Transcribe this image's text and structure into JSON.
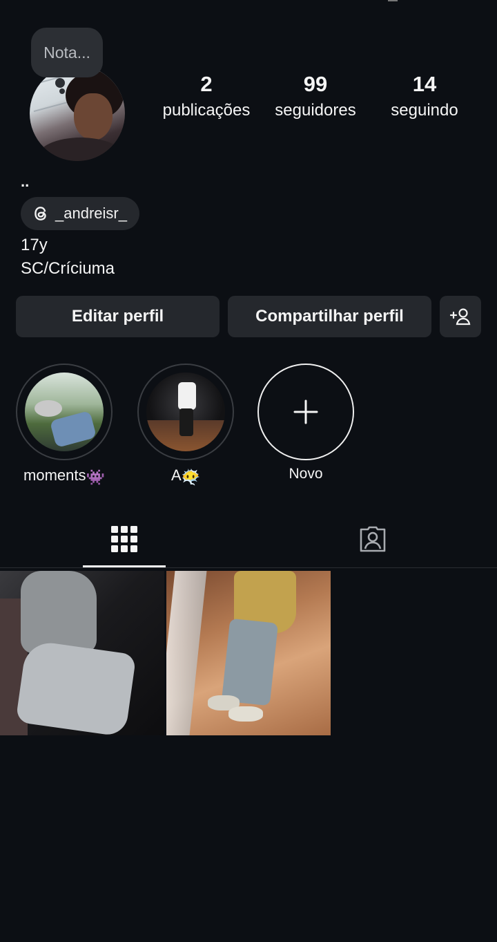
{
  "profile": {
    "note": "Nota...",
    "name": "..",
    "threads_handle": "_andreisr_",
    "bio_lines": [
      "17y",
      "SC/Críciuma"
    ]
  },
  "stats": [
    {
      "value": "2",
      "label": "publicações"
    },
    {
      "value": "99",
      "label": "seguidores"
    },
    {
      "value": "14",
      "label": "seguindo"
    }
  ],
  "buttons": {
    "edit": "Editar perfil",
    "share": "Compartilhar perfil"
  },
  "highlights": [
    {
      "label": "moments",
      "emoji": "👾"
    },
    {
      "label": "A",
      "emoji": "😶‍🌫️"
    },
    {
      "label": "Novo"
    }
  ],
  "tabs": [
    {
      "icon": "grid-icon",
      "active": true
    },
    {
      "icon": "tagged-person-icon",
      "active": false
    }
  ],
  "icons": {
    "threads": "threads-icon",
    "add_person": "add-person-icon",
    "plus": "plus-icon"
  },
  "colors": {
    "background": "#0c0f14",
    "button": "#25282d",
    "text": "#f5f5f5"
  }
}
